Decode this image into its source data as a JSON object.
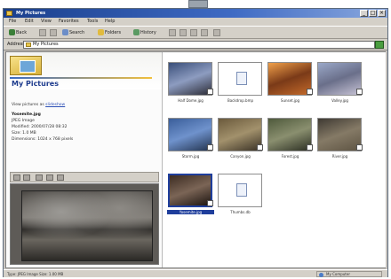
{
  "window": {
    "title": "My Pictures",
    "buttons": [
      "_",
      "□",
      "×"
    ]
  },
  "menubar": [
    "File",
    "Edit",
    "View",
    "Favorites",
    "Tools",
    "Help"
  ],
  "toolbar": {
    "back": "Back",
    "search": "Search",
    "folders": "Folders",
    "history": "History"
  },
  "address": {
    "label": "Address",
    "value": "My Pictures"
  },
  "left_pane": {
    "folder_name": "My Pictures",
    "view_link_prefix": "View pictures as ",
    "view_link": "slideshow",
    "file_name": "Yosemite.jpg",
    "file_type": "JPEG Image",
    "modified": "Modified: 2000/07/28 08:32",
    "size": "Size: 1.0 MB",
    "dimensions": "Dimensions: 1024 x 768 pixels"
  },
  "thumbnails": [
    {
      "caption": "Half Dome.jpg",
      "colors": [
        "#3a4f7a",
        "#8d9cc0",
        "#2c2c36"
      ],
      "selected": false,
      "doc": false
    },
    {
      "caption": "Backdrop.bmp",
      "colors": [
        "#ffffff",
        "#ffffff",
        "#ffffff"
      ],
      "selected": false,
      "doc": true
    },
    {
      "caption": "Sunset.jpg",
      "colors": [
        "#f0a04a",
        "#7a3a18",
        "#c46a2a"
      ],
      "selected": false,
      "doc": false
    },
    {
      "caption": "Valley.jpg",
      "colors": [
        "#9aa8c8",
        "#6a6f8a",
        "#c7c3d5"
      ],
      "selected": false,
      "doc": false
    },
    {
      "caption": "Storm.jpg",
      "colors": [
        "#3a5e9a",
        "#6f92cc",
        "#23344f"
      ],
      "selected": false,
      "doc": false
    },
    {
      "caption": "Canyon.jpg",
      "colors": [
        "#6b5a3c",
        "#a2916c",
        "#3a3226"
      ],
      "selected": false,
      "doc": false
    },
    {
      "caption": "Forest.jpg",
      "colors": [
        "#4f5a3c",
        "#8a8f6f",
        "#2c2f23"
      ],
      "selected": false,
      "doc": false
    },
    {
      "caption": "River.jpg",
      "colors": [
        "#3f3a33",
        "#857a66",
        "#5e5443"
      ],
      "selected": false,
      "doc": false
    },
    {
      "caption": "Yosemite.jpg",
      "colors": [
        "#3c2c22",
        "#7b6556",
        "#1c1410"
      ],
      "selected": true,
      "doc": false
    },
    {
      "caption": "Thumbs.db",
      "colors": [
        "#ffffff",
        "#ffffff",
        "#ffffff"
      ],
      "selected": false,
      "doc": true
    }
  ],
  "status": {
    "left": "Type: JPEG Image Size: 1.00 MB",
    "zone": "My Computer"
  },
  "colors": {
    "title_bar": "#1a3f8c",
    "selection": "#1f3e9c",
    "link": "#2c4fb6"
  }
}
